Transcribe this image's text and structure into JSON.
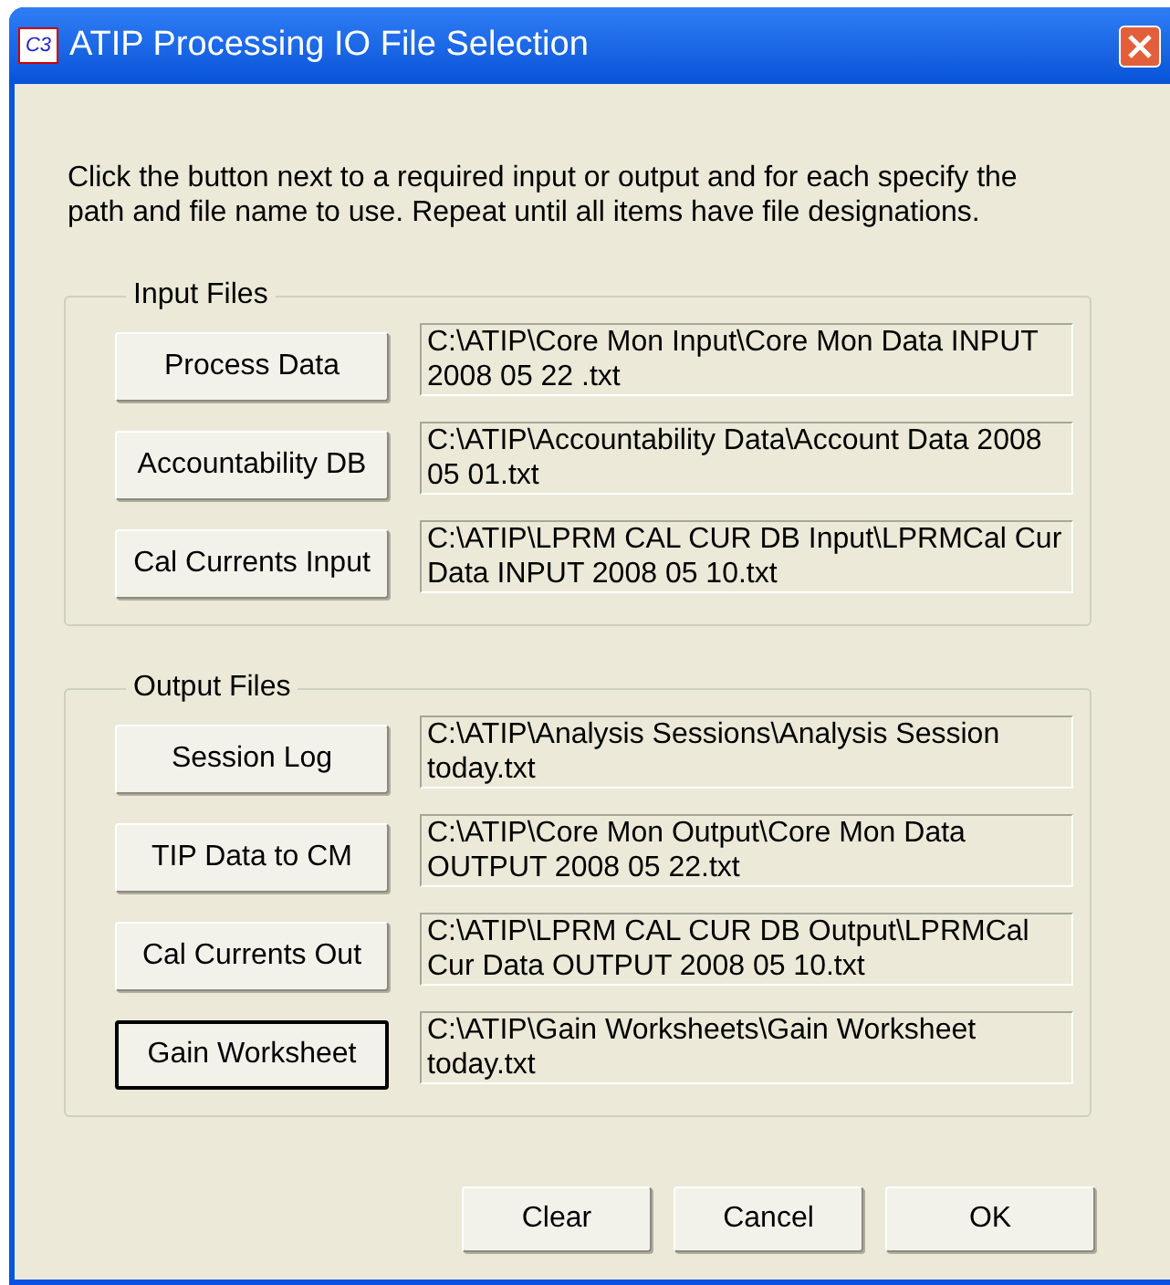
{
  "window": {
    "title": "ATIP Processing IO File Selection",
    "icon_text": "C3"
  },
  "instructions": "Click the button next to a required input or output and for each specify the path and file name to use. Repeat until all items have file designations.",
  "groups": [
    {
      "title": "Input Files",
      "items": [
        {
          "button": "Process Data",
          "focused": false,
          "path": "C:\\ATIP\\Core Mon Input\\Core Mon Data INPUT 2008 05 22 .txt"
        },
        {
          "button": "Accountability DB",
          "focused": false,
          "path": "C:\\ATIP\\Accountability Data\\Account Data 2008 05 01.txt"
        },
        {
          "button": "Cal Currents Input",
          "focused": false,
          "path": "C:\\ATIP\\LPRM CAL CUR DB Input\\LPRMCal Cur Data INPUT 2008 05 10.txt"
        }
      ]
    },
    {
      "title": "Output Files",
      "items": [
        {
          "button": "Session Log",
          "focused": false,
          "path": "C:\\ATIP\\Analysis Sessions\\Analysis Session today.txt"
        },
        {
          "button": "TIP Data to CM",
          "focused": false,
          "path": "C:\\ATIP\\Core Mon Output\\Core Mon Data OUTPUT 2008 05 22.txt"
        },
        {
          "button": "Cal Currents Out",
          "focused": false,
          "path": "C:\\ATIP\\LPRM CAL CUR DB Output\\LPRMCal Cur Data OUTPUT 2008 05 10.txt"
        },
        {
          "button": "Gain Worksheet",
          "focused": true,
          "path": "C:\\ATIP\\Gain Worksheets\\Gain Worksheet today.txt"
        }
      ]
    }
  ],
  "buttons": [
    "Clear",
    "Cancel",
    "OK"
  ]
}
